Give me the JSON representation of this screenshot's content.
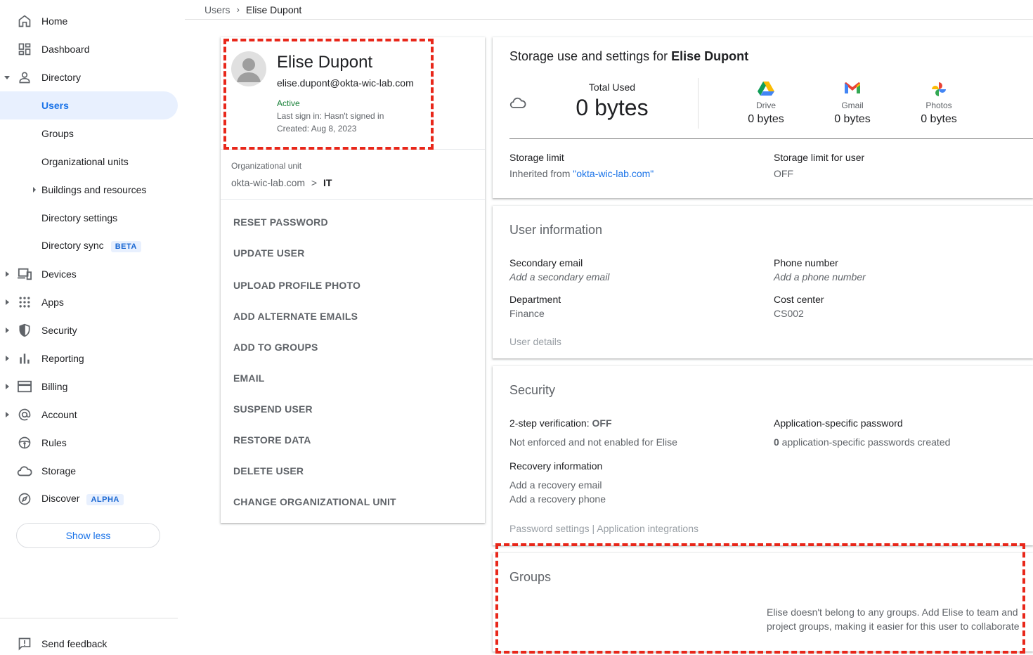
{
  "breadcrumb": {
    "parent": "Users",
    "separator": "›",
    "current": "Elise Dupont"
  },
  "sidebar": {
    "items": [
      {
        "label": "Home"
      },
      {
        "label": "Dashboard"
      },
      {
        "label": "Directory"
      },
      {
        "label": "Users"
      },
      {
        "label": "Groups"
      },
      {
        "label": "Organizational units"
      },
      {
        "label": "Buildings and resources"
      },
      {
        "label": "Directory settings"
      },
      {
        "label": "Directory sync",
        "badge": "BETA"
      },
      {
        "label": "Devices"
      },
      {
        "label": "Apps"
      },
      {
        "label": "Security"
      },
      {
        "label": "Reporting"
      },
      {
        "label": "Billing"
      },
      {
        "label": "Account"
      },
      {
        "label": "Rules"
      },
      {
        "label": "Storage"
      },
      {
        "label": "Discover",
        "badge": "ALPHA"
      }
    ],
    "show_less": "Show less",
    "feedback": "Send feedback"
  },
  "user": {
    "name": "Elise Dupont",
    "email": "elise.dupont@okta-wic-lab.com",
    "status": "Active",
    "last_sign_in": "Last sign in: Hasn't signed in",
    "created": "Created: Aug 8, 2023",
    "ou_label": "Organizational unit",
    "ou_root": "okta-wic-lab.com",
    "ou_sep": ">",
    "ou_leaf": "IT"
  },
  "actions": [
    "RESET PASSWORD",
    "UPDATE USER",
    "UPLOAD PROFILE PHOTO",
    "ADD ALTERNATE EMAILS",
    "ADD TO GROUPS",
    "EMAIL",
    "SUSPEND USER",
    "RESTORE DATA",
    "DELETE USER",
    "CHANGE ORGANIZATIONAL UNIT"
  ],
  "storage": {
    "title_prefix": "Storage use and settings for ",
    "title_name": "Elise Dupont",
    "total_label": "Total Used",
    "total_value": "0 bytes",
    "products": [
      {
        "name": "Drive",
        "value": "0 bytes"
      },
      {
        "name": "Gmail",
        "value": "0 bytes"
      },
      {
        "name": "Photos",
        "value": "0 bytes"
      }
    ],
    "limit_label": "Storage limit",
    "limit_prefix": "Inherited from ",
    "limit_link": "\"okta-wic-lab.com\"",
    "user_limit_label": "Storage limit for user",
    "user_limit_value": "OFF"
  },
  "user_info": {
    "title": "User information",
    "secondary_email_label": "Secondary email",
    "secondary_email_hint": "Add a secondary email",
    "phone_label": "Phone number",
    "phone_hint": "Add a phone number",
    "department_label": "Department",
    "department_value": "Finance",
    "cost_center_label": "Cost center",
    "cost_center_value": "CS002",
    "details_link": "User details"
  },
  "security": {
    "title": "Security",
    "two_step_label": "2-step verification: ",
    "two_step_value": "OFF",
    "two_step_desc": "Not enforced and not enabled for Elise",
    "app_pw_label": "Application-specific password",
    "app_pw_count": "0",
    "app_pw_desc": " application-specific passwords created",
    "recovery_label": "Recovery information",
    "recovery_email": "Add a recovery email",
    "recovery_phone": "Add a recovery phone",
    "links": "Password settings | Application integrations"
  },
  "groups": {
    "title": "Groups",
    "message": "Elise doesn't belong to any groups. Add Elise to team and project groups, making it easier for this user to collaborate"
  },
  "colors": {
    "accent": "#1a73e8",
    "active_bg": "#e8f0fe",
    "status_green": "#188038",
    "highlight_dash": "#e8271a"
  }
}
